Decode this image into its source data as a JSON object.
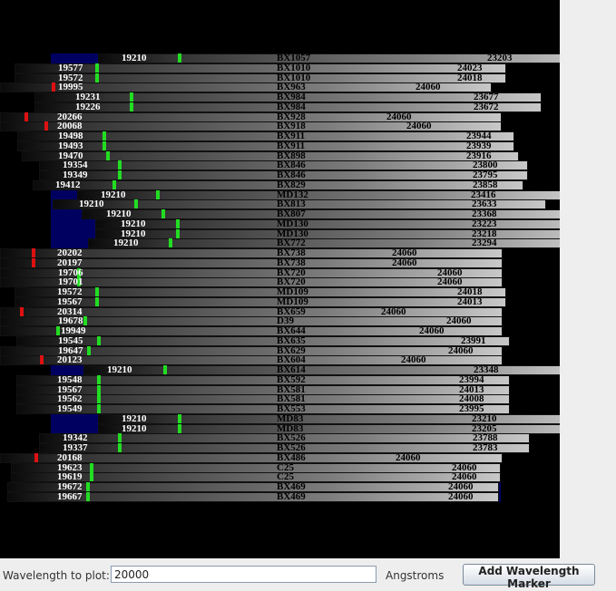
{
  "plot": {
    "colors": {
      "background": "#000000",
      "block_color": "#000060",
      "marker_green": "#22dd22",
      "marker_red": "#dd1111"
    },
    "rows": [
      {
        "name": "BX1057",
        "left": "19210",
        "right": "23203",
        "marker": "green"
      },
      {
        "name": "BX1010",
        "left": "19577",
        "right": "24023",
        "marker": "green"
      },
      {
        "name": "BX1010",
        "left": "19572",
        "right": "24018",
        "marker": "green"
      },
      {
        "name": "BX963",
        "left": "19995",
        "right": "24060",
        "marker": "red"
      },
      {
        "name": "BX984",
        "left": "19231",
        "right": "23677",
        "marker": "green"
      },
      {
        "name": "BX984",
        "left": "19226",
        "right": "23672",
        "marker": "green"
      },
      {
        "name": "BX928",
        "left": "20266",
        "right": "24060",
        "marker": "red"
      },
      {
        "name": "BX918",
        "left": "20068",
        "right": "24060",
        "marker": "red"
      },
      {
        "name": "BX911",
        "left": "19498",
        "right": "23944",
        "marker": "green"
      },
      {
        "name": "BX911",
        "left": "19493",
        "right": "23939",
        "marker": "green"
      },
      {
        "name": "BX898",
        "left": "19470",
        "right": "23916",
        "marker": "green"
      },
      {
        "name": "BX846",
        "left": "19354",
        "right": "23800",
        "marker": "green"
      },
      {
        "name": "BX846",
        "left": "19349",
        "right": "23795",
        "marker": "green"
      },
      {
        "name": "BX829",
        "left": "19412",
        "right": "23858",
        "marker": "green"
      },
      {
        "name": "MD132",
        "left": "19210",
        "right": "23416",
        "marker": "green"
      },
      {
        "name": "BX813",
        "left": "19210",
        "right": "23633",
        "marker": "green"
      },
      {
        "name": "BX807",
        "left": "19210",
        "right": "23368",
        "marker": "green"
      },
      {
        "name": "MD130",
        "left": "19210",
        "right": "23223",
        "marker": "green"
      },
      {
        "name": "MD130",
        "left": "19210",
        "right": "23218",
        "marker": "green"
      },
      {
        "name": "BX772",
        "left": "19210",
        "right": "23294",
        "marker": "green"
      },
      {
        "name": "BX738",
        "left": "20202",
        "right": "24060",
        "marker": "red"
      },
      {
        "name": "BX738",
        "left": "20197",
        "right": "24060",
        "marker": "red"
      },
      {
        "name": "BX720",
        "left": "19706",
        "right": "24060",
        "marker": "green"
      },
      {
        "name": "BX720",
        "left": "19701",
        "right": "24060",
        "marker": "green"
      },
      {
        "name": "MD109",
        "left": "19572",
        "right": "24018",
        "marker": "green"
      },
      {
        "name": "MD109",
        "left": "19567",
        "right": "24013",
        "marker": "green"
      },
      {
        "name": "BX659",
        "left": "20314",
        "right": "24060",
        "marker": "red"
      },
      {
        "name": "D39",
        "left": "19678",
        "right": "24060",
        "marker": "green"
      },
      {
        "name": "BX644",
        "left": "19949",
        "right": "24060",
        "marker": "green"
      },
      {
        "name": "BX635",
        "left": "19545",
        "right": "23991",
        "marker": "green"
      },
      {
        "name": "BX629",
        "left": "19647",
        "right": "24060",
        "marker": "green"
      },
      {
        "name": "BX604",
        "left": "20123",
        "right": "24060",
        "marker": "red"
      },
      {
        "name": "BX614",
        "left": "19210",
        "right": "23348",
        "marker": "green"
      },
      {
        "name": "BX592",
        "left": "19548",
        "right": "23994",
        "marker": "green"
      },
      {
        "name": "BX581",
        "left": "19567",
        "right": "24013",
        "marker": "green"
      },
      {
        "name": "BX581",
        "left": "19562",
        "right": "24008",
        "marker": "green"
      },
      {
        "name": "BX553",
        "left": "19549",
        "right": "23995",
        "marker": "green"
      },
      {
        "name": "MD83",
        "left": "19210",
        "right": "23210",
        "marker": "green"
      },
      {
        "name": "MD83",
        "left": "19210",
        "right": "23205",
        "marker": "green"
      },
      {
        "name": "BX526",
        "left": "19342",
        "right": "23788",
        "marker": "green"
      },
      {
        "name": "BX526",
        "left": "19337",
        "right": "23783",
        "marker": "green"
      },
      {
        "name": "BX486",
        "left": "20168",
        "right": "24060",
        "marker": "red"
      },
      {
        "name": "C25",
        "left": "19623",
        "right": "24060",
        "marker": "green"
      },
      {
        "name": "C25",
        "left": "19619",
        "right": "24060",
        "marker": "green"
      },
      {
        "name": "BX469",
        "left": "19672",
        "right": "24060",
        "marker": "green"
      },
      {
        "name": "BX469",
        "left": "19667",
        "right": "24060",
        "marker": "green"
      }
    ]
  },
  "controls": {
    "wavelength_label": "Wavelength to plot:",
    "wavelength_value": "20000",
    "units_label": "Angstroms",
    "add_button_label": "Add Wavelength Marker"
  }
}
